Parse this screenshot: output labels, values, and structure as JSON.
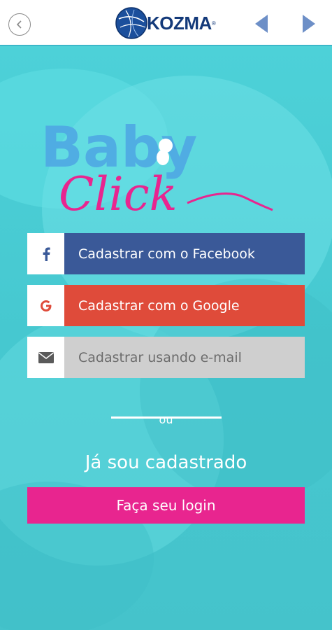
{
  "header": {
    "logo_text": "KOZMA",
    "logo_tm": "®"
  },
  "brand": {
    "line1": "Baby",
    "line2": "Click"
  },
  "signup": {
    "facebook_label": "Cadastrar com o Facebook",
    "google_label": "Cadastrar com o Google",
    "email_label": "Cadastrar usando e-mail"
  },
  "divider_text": "ou",
  "login": {
    "heading": "Já sou cadastrado",
    "button_label": "Faça seu login"
  },
  "colors": {
    "facebook": "#3a5998",
    "google": "#df4b3a",
    "email": "#cfcfcf",
    "login": "#e8258f",
    "background": "#4fd2d8",
    "header_nav": "#6d8fc7"
  }
}
